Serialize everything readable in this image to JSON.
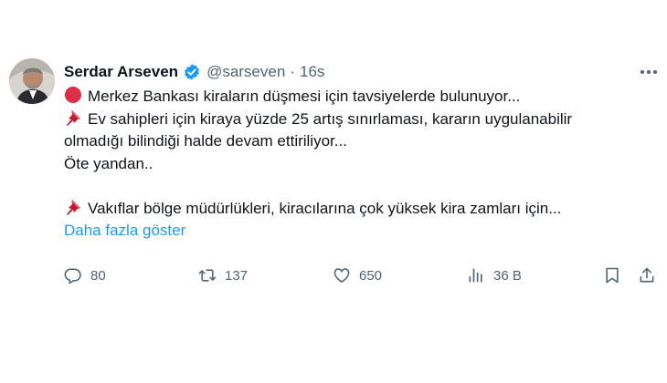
{
  "tweet": {
    "author": {
      "display_name": "Serdar Arseven",
      "handle": "@sarseven",
      "separator": "·",
      "time": "16s"
    },
    "lines": {
      "l1": "Merkez Bankası kiraların düşmesi için tavsiyelerde bulunuyor...",
      "l2": "Ev sahipleri için kiraya  yüzde 25 artış sınırlaması, kararın uygulanabilir",
      "l3": "olmadığı bilindiği halde devam ettiriliyor...",
      "l4": "Öte yandan..",
      "l5": "Vakıflar bölge müdürlükleri, kiracılarına çok yüksek kira zamları için..."
    },
    "show_more": "Daha fazla göster",
    "metrics": {
      "replies": "80",
      "retweets": "137",
      "likes": "650",
      "views": "36 B"
    }
  },
  "icons": {
    "verified": "verified-badge-icon",
    "more": "more-horizontal-icon",
    "reply": "reply-icon",
    "retweet": "retweet-icon",
    "like": "heart-icon",
    "views": "views-icon",
    "bookmark": "bookmark-icon",
    "share": "share-icon",
    "bullet_red": "red-circle-icon",
    "pin": "pushpin-icon"
  },
  "colors": {
    "text": "#0f1419",
    "secondary": "#536471",
    "link": "#1d9bf0",
    "verified": "#1d9bf0",
    "red_circle": "#dd2e44",
    "pin": "#be1931"
  }
}
